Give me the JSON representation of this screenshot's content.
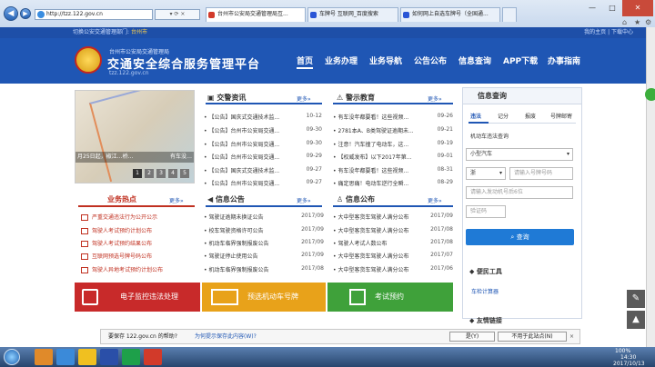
{
  "browser": {
    "address": "http://tzz.122.gov.cn",
    "tabs": [
      {
        "label": "台州市公安局交通管理局互..."
      },
      {
        "label": "车牌号 互联网_百度搜索"
      },
      {
        "label": "如何网上自选车牌号（全国通..."
      }
    ]
  },
  "site": {
    "top_left": "切换公安交通管理部门:",
    "top_city": "台州市",
    "top_right": "我的主页 | 下载中心",
    "org": "台州市公安局交通管理局",
    "title": "交通安全综合服务管理平台",
    "domain": "tzz.122.gov.cn"
  },
  "menu": [
    "首页",
    "业务办理",
    "业务导航",
    "公告公布",
    "信息查询",
    "APP下载",
    "办事指南"
  ],
  "banner": {
    "caption": "月25日起，椒江…桥…",
    "caption_right": "有车没…",
    "pages": [
      "1",
      "2",
      "3",
      "4",
      "5"
    ]
  },
  "news": {
    "title": "交警资讯",
    "more": "更多»",
    "items": [
      {
        "text": "【公告】国庆式交通技术监...",
        "date": "10-12"
      },
      {
        "text": "【公告】台州市公安局交通...",
        "date": "09-30"
      },
      {
        "text": "【公告】台州市公安局交通...",
        "date": "09-30"
      },
      {
        "text": "【公告】台州市公安局交通...",
        "date": "09-29"
      },
      {
        "text": "【公告】国庆式交通技术监...",
        "date": "09-27"
      },
      {
        "text": "【公告】台州市公安局交通...",
        "date": "09-27"
      }
    ]
  },
  "warning": {
    "title": "警示教育",
    "more": "更多»",
    "items": [
      {
        "text": "有车没年都要看！这些视频...",
        "date": "09-26"
      },
      {
        "text": "2781本A、B类驾驶证逾期未...",
        "date": "09-21"
      },
      {
        "text": "注意！汽车撞了电动车，这...",
        "date": "09-19"
      },
      {
        "text": "【权威发布】以下2017年第...",
        "date": "09-01"
      },
      {
        "text": "有车没年都要看！这些视频...",
        "date": "08-31"
      },
      {
        "text": "痛定思痛！电动车逆行全瞬...",
        "date": "08-29"
      }
    ]
  },
  "hot": {
    "title": "业务热点",
    "more": "更多»",
    "items": [
      "严重交通违法行为公开公示",
      "驾驶人考试预约计划公布",
      "驾驶人考试预约结果公布",
      "互联网预选号牌号码公布",
      "驾驶人异地考试预约计划公布"
    ]
  },
  "notices": {
    "title": "信息公告",
    "more": "更多»",
    "items": [
      {
        "text": "驾驶证逾期未换证公告",
        "date": "2017/09"
      },
      {
        "text": "校车驾驶资格许可公告",
        "date": "2017/09"
      },
      {
        "text": "机动车临界强制报废公告",
        "date": "2017/09"
      },
      {
        "text": "驾驶证停止使用公告",
        "date": "2017/09"
      },
      {
        "text": "机动车临界强制报废公告",
        "date": "2017/08"
      }
    ]
  },
  "publicity": {
    "title": "信息公布",
    "more": "更多»",
    "items": [
      {
        "text": "大中型客货车驾驶人满分公布",
        "date": "2017/09"
      },
      {
        "text": "大中型客货车驾驶人满分公布",
        "date": "2017/08"
      },
      {
        "text": "驾驶人考试人数公布",
        "date": "2017/08"
      },
      {
        "text": "大中型客货车驾驶人满分公布",
        "date": "2017/07"
      },
      {
        "text": "大中型客货车驾驶人满分公布",
        "date": "2017/06"
      }
    ]
  },
  "query": {
    "title": "信息查询",
    "tabs": [
      "违法",
      "记分",
      "报废",
      "号牌邮寄"
    ],
    "section": "机动车违法查询",
    "vehicle_type": "小型汽车",
    "province": "浙",
    "plate_placeholder": "请输入号牌号码",
    "engine_placeholder": "请输入发动机号后6位",
    "captcha_placeholder": "验证码",
    "button": "查询",
    "tools_title": "便民工具",
    "tools_link": "车检计算器",
    "links_title": "友情链接"
  },
  "quick": [
    {
      "label": "电子监控违法处理",
      "color": "#c82a2a"
    },
    {
      "label": "预选机动车号牌",
      "color": "#e8a21a"
    },
    {
      "label": "考试预约",
      "color": "#3fa13a"
    }
  ],
  "download": {
    "question": "要保存 122.gov.cn 的帮助?",
    "link": "为何提示保存此内容(W)?",
    "yes": "是(Y)",
    "no": "不用于此站点(N)"
  },
  "taskbar": {
    "zoom": "100%",
    "time": "14:30",
    "date": "2017/10/13"
  }
}
